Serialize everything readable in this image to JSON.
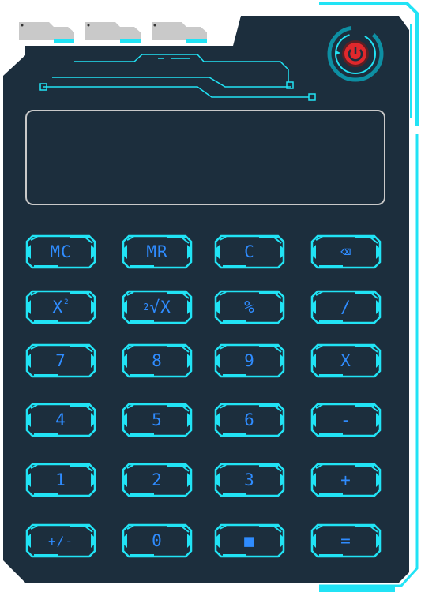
{
  "colors": {
    "panel": "#1c2e3d",
    "neon": "#21e3f5",
    "neon_dark": "#0d8fa3",
    "text": "#2f8cff",
    "power_red": "#e0282c",
    "tab_gray": "#c9c9c9"
  },
  "display": {
    "value": ""
  },
  "power_button": {
    "icon": "power-icon"
  },
  "keys": [
    {
      "label": "MC"
    },
    {
      "label": "MR"
    },
    {
      "label": "C"
    },
    {
      "label": "⌫",
      "icon": "backspace-icon"
    },
    {
      "label": "X",
      "sup": "2"
    },
    {
      "label": "√X",
      "pre": "2"
    },
    {
      "label": "%"
    },
    {
      "label": "/"
    },
    {
      "label": "7"
    },
    {
      "label": "8"
    },
    {
      "label": "9"
    },
    {
      "label": "X"
    },
    {
      "label": "4"
    },
    {
      "label": "5"
    },
    {
      "label": "6"
    },
    {
      "label": "-"
    },
    {
      "label": "1"
    },
    {
      "label": "2"
    },
    {
      "label": "3"
    },
    {
      "label": "+"
    },
    {
      "label": "+/-"
    },
    {
      "label": "0"
    },
    {
      "label": "■"
    },
    {
      "label": "="
    }
  ]
}
